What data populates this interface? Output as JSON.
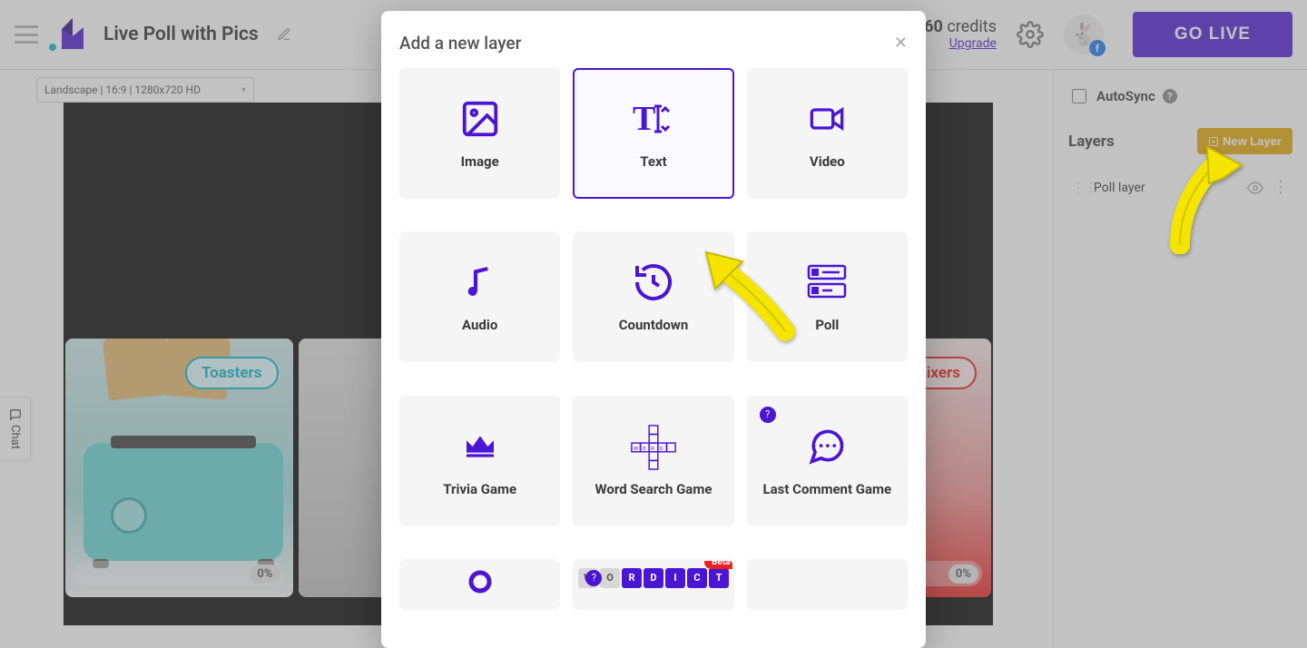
{
  "header": {
    "page_title": "Live Poll with Pics",
    "credits_value": "60",
    "credits_label": "credits",
    "upgrade_label": "Upgrade",
    "golive_label": "GO LIVE"
  },
  "canvas": {
    "resolution_label": "Landscape | 16:9 | 1280x720 HD",
    "poll_cards": [
      {
        "label": "Toasters",
        "pct": "0%"
      },
      {
        "label": "Mixers",
        "pct": "0%"
      }
    ]
  },
  "chat_tab": "Chat",
  "sidebar": {
    "autosync_label": "AutoSync",
    "layers_heading": "Layers",
    "newlayer_label": "New Layer",
    "layers": [
      {
        "name": "Poll layer"
      }
    ]
  },
  "modal": {
    "title": "Add a new layer",
    "tiles": [
      {
        "label": "Image",
        "icon": "image",
        "selected": false
      },
      {
        "label": "Text",
        "icon": "text",
        "selected": true
      },
      {
        "label": "Video",
        "icon": "video",
        "selected": false
      },
      {
        "label": "Audio",
        "icon": "audio",
        "selected": false
      },
      {
        "label": "Countdown",
        "icon": "countdown",
        "selected": false
      },
      {
        "label": "Poll",
        "icon": "poll",
        "selected": false
      },
      {
        "label": "Trivia Game",
        "icon": "trivia",
        "selected": false
      },
      {
        "label": "Word Search Game",
        "icon": "wordsearch",
        "selected": false
      },
      {
        "label": "Last Comment Game",
        "icon": "comment",
        "selected": false,
        "help": true
      }
    ],
    "partial_tiles": [
      {
        "icon": "circle"
      },
      {
        "icon": "wordict",
        "help": true,
        "beta": true
      }
    ],
    "beta_label": "Beta",
    "wordict_letters": [
      "W",
      "O",
      "R",
      "D",
      "I",
      "C",
      "T"
    ]
  }
}
